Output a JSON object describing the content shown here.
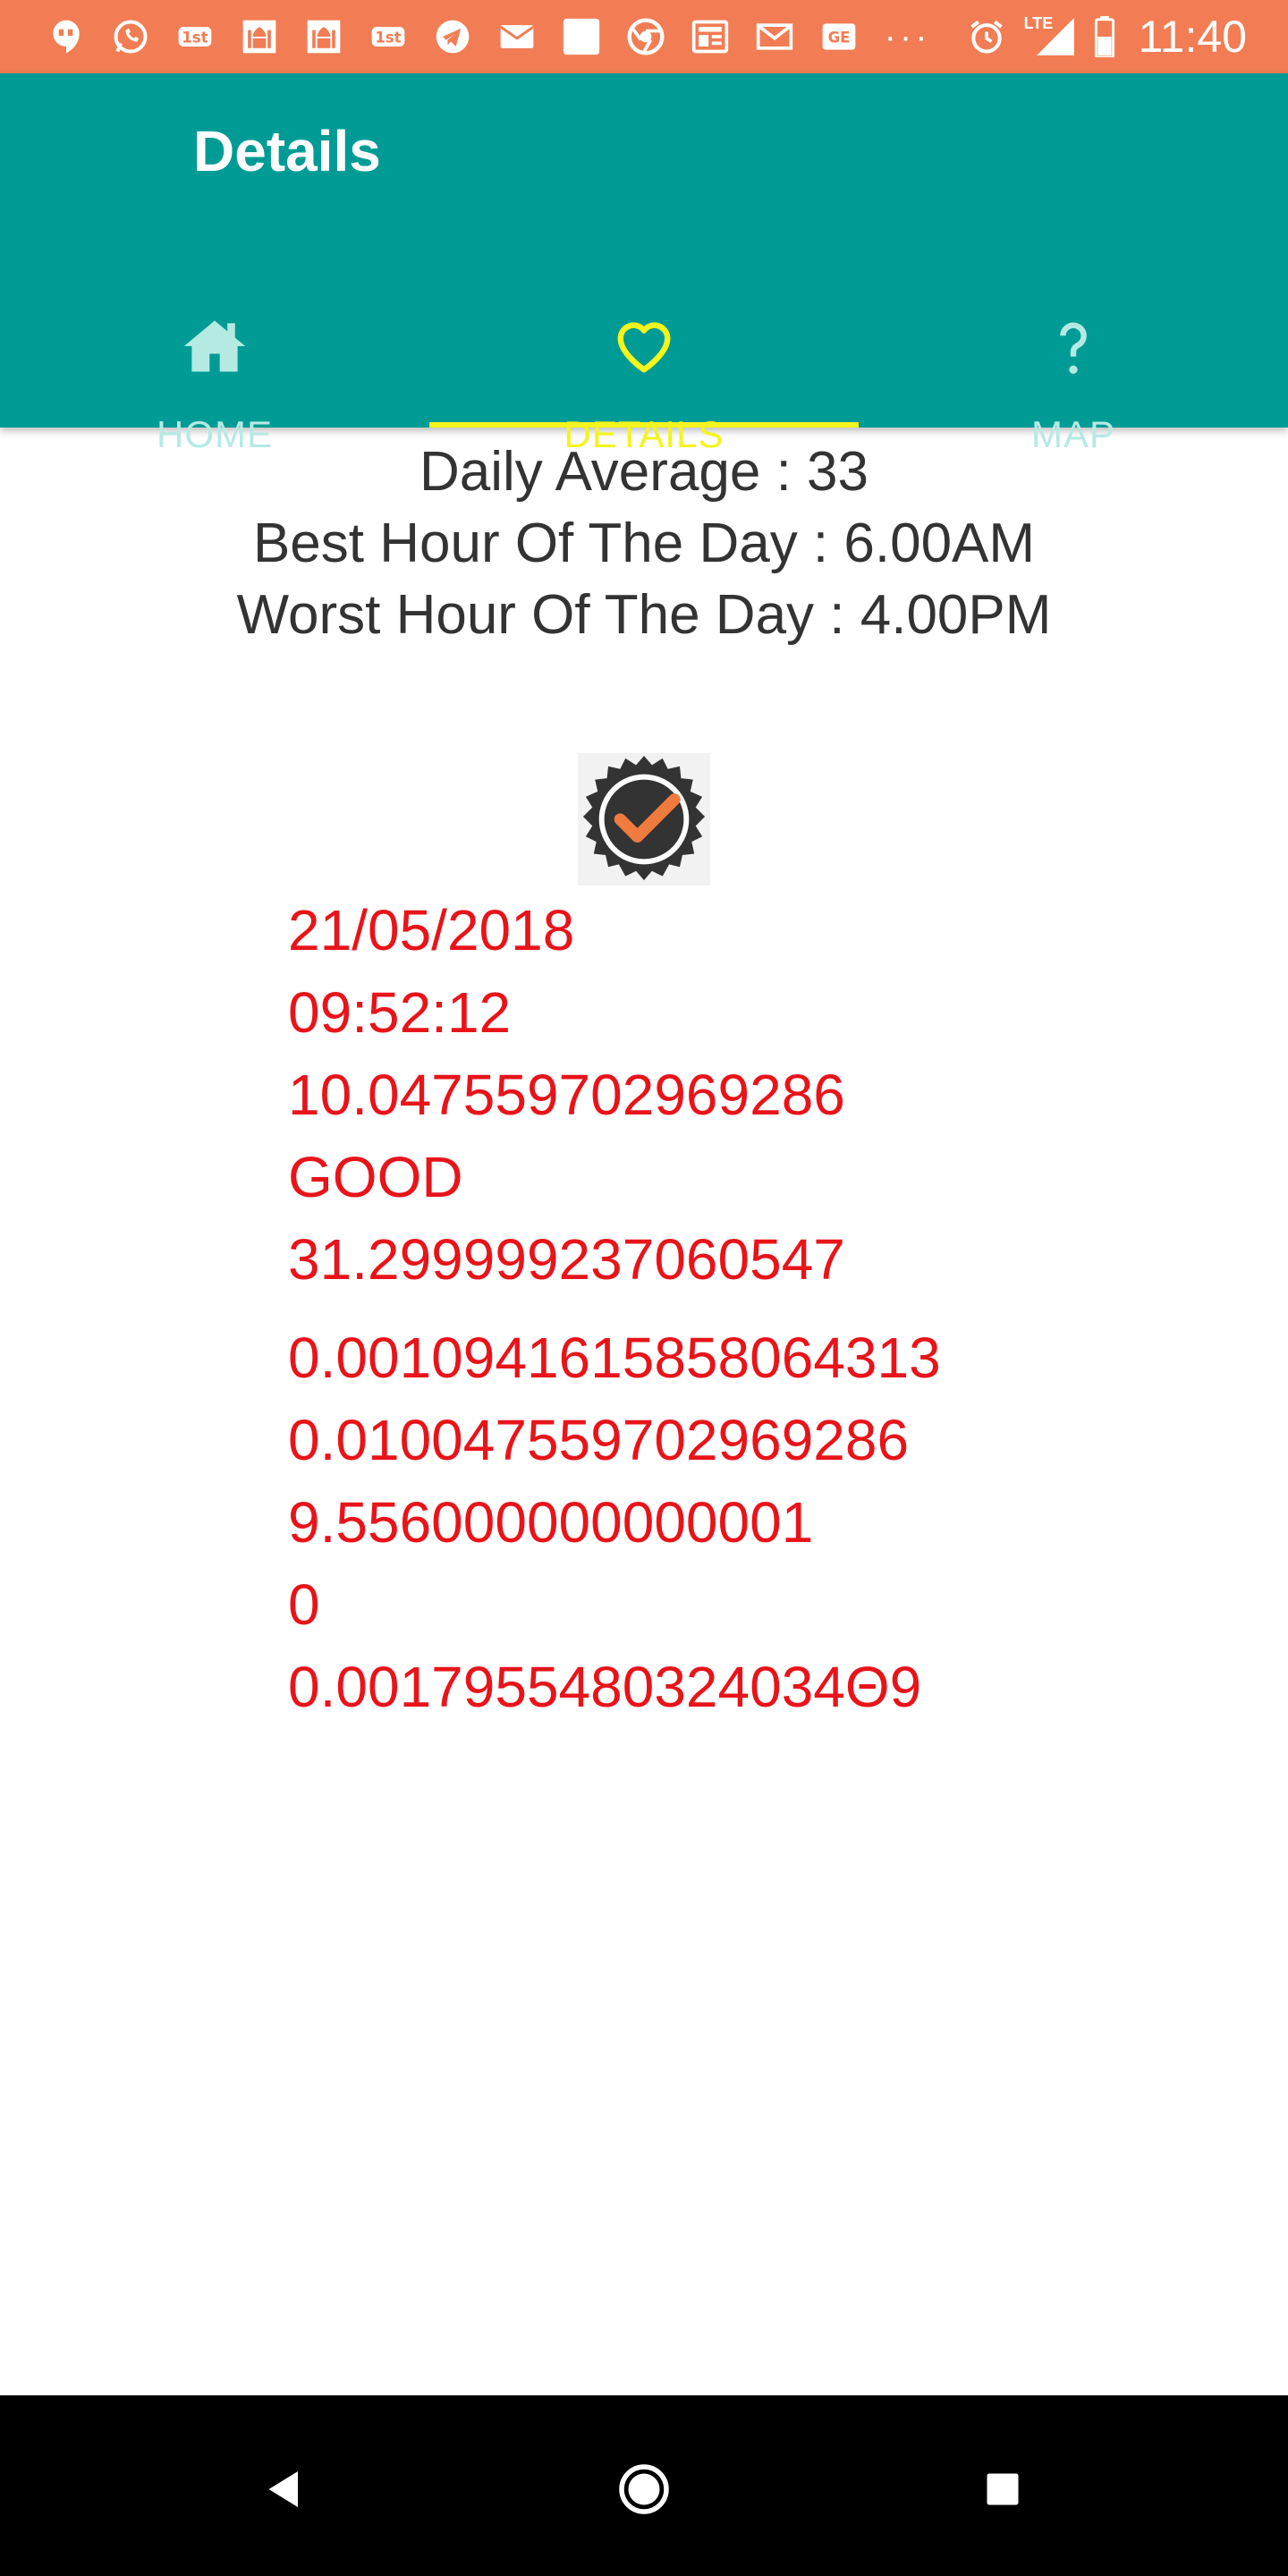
{
  "status_bar": {
    "time": "11:40",
    "overflow": "···",
    "network": "LTE",
    "notification_icons": [
      "hangouts-icon",
      "whatsapp-icon",
      "1st-icon",
      "mosque-icon",
      "mosque-icon",
      "1st-icon",
      "telegram-icon",
      "email-icon",
      "square-icon",
      "chrome-icon",
      "news-icon",
      "gmail-icon",
      "ge-icon"
    ]
  },
  "app_bar": {
    "title": "Details",
    "tabs": [
      {
        "label": "HOME",
        "icon": "home-icon"
      },
      {
        "label": "DETAILS",
        "icon": "heart-icon"
      },
      {
        "label": "MAP",
        "icon": "question-icon"
      }
    ],
    "selected_tab": "DETAILS",
    "colors": {
      "bar": "#009B95",
      "selected": "#F3F51C",
      "unselected": "#B5EAE3"
    }
  },
  "summary": {
    "daily_average": "Daily Average : 33",
    "best_hour": "Best Hour Of The Day : 6.00AM",
    "worst_hour": "Worst Hour Of The Day : 4.00PM"
  },
  "badge": {
    "icon": "check-badge-icon",
    "colors": {
      "ring": "#333333",
      "check": "#F07B3F"
    }
  },
  "values": [
    "21/05/2018",
    "09:52:12",
    "10.047559702969286",
    "GOOD",
    "31.299999237060547",
    "0.0010941615858064313",
    "0.010047559702969286",
    "9.556000000000001",
    "0",
    "0.0017955480324034Θ9"
  ],
  "nav_bar": {
    "buttons": [
      "back-icon",
      "home-circle-icon",
      "recents-icon"
    ]
  }
}
